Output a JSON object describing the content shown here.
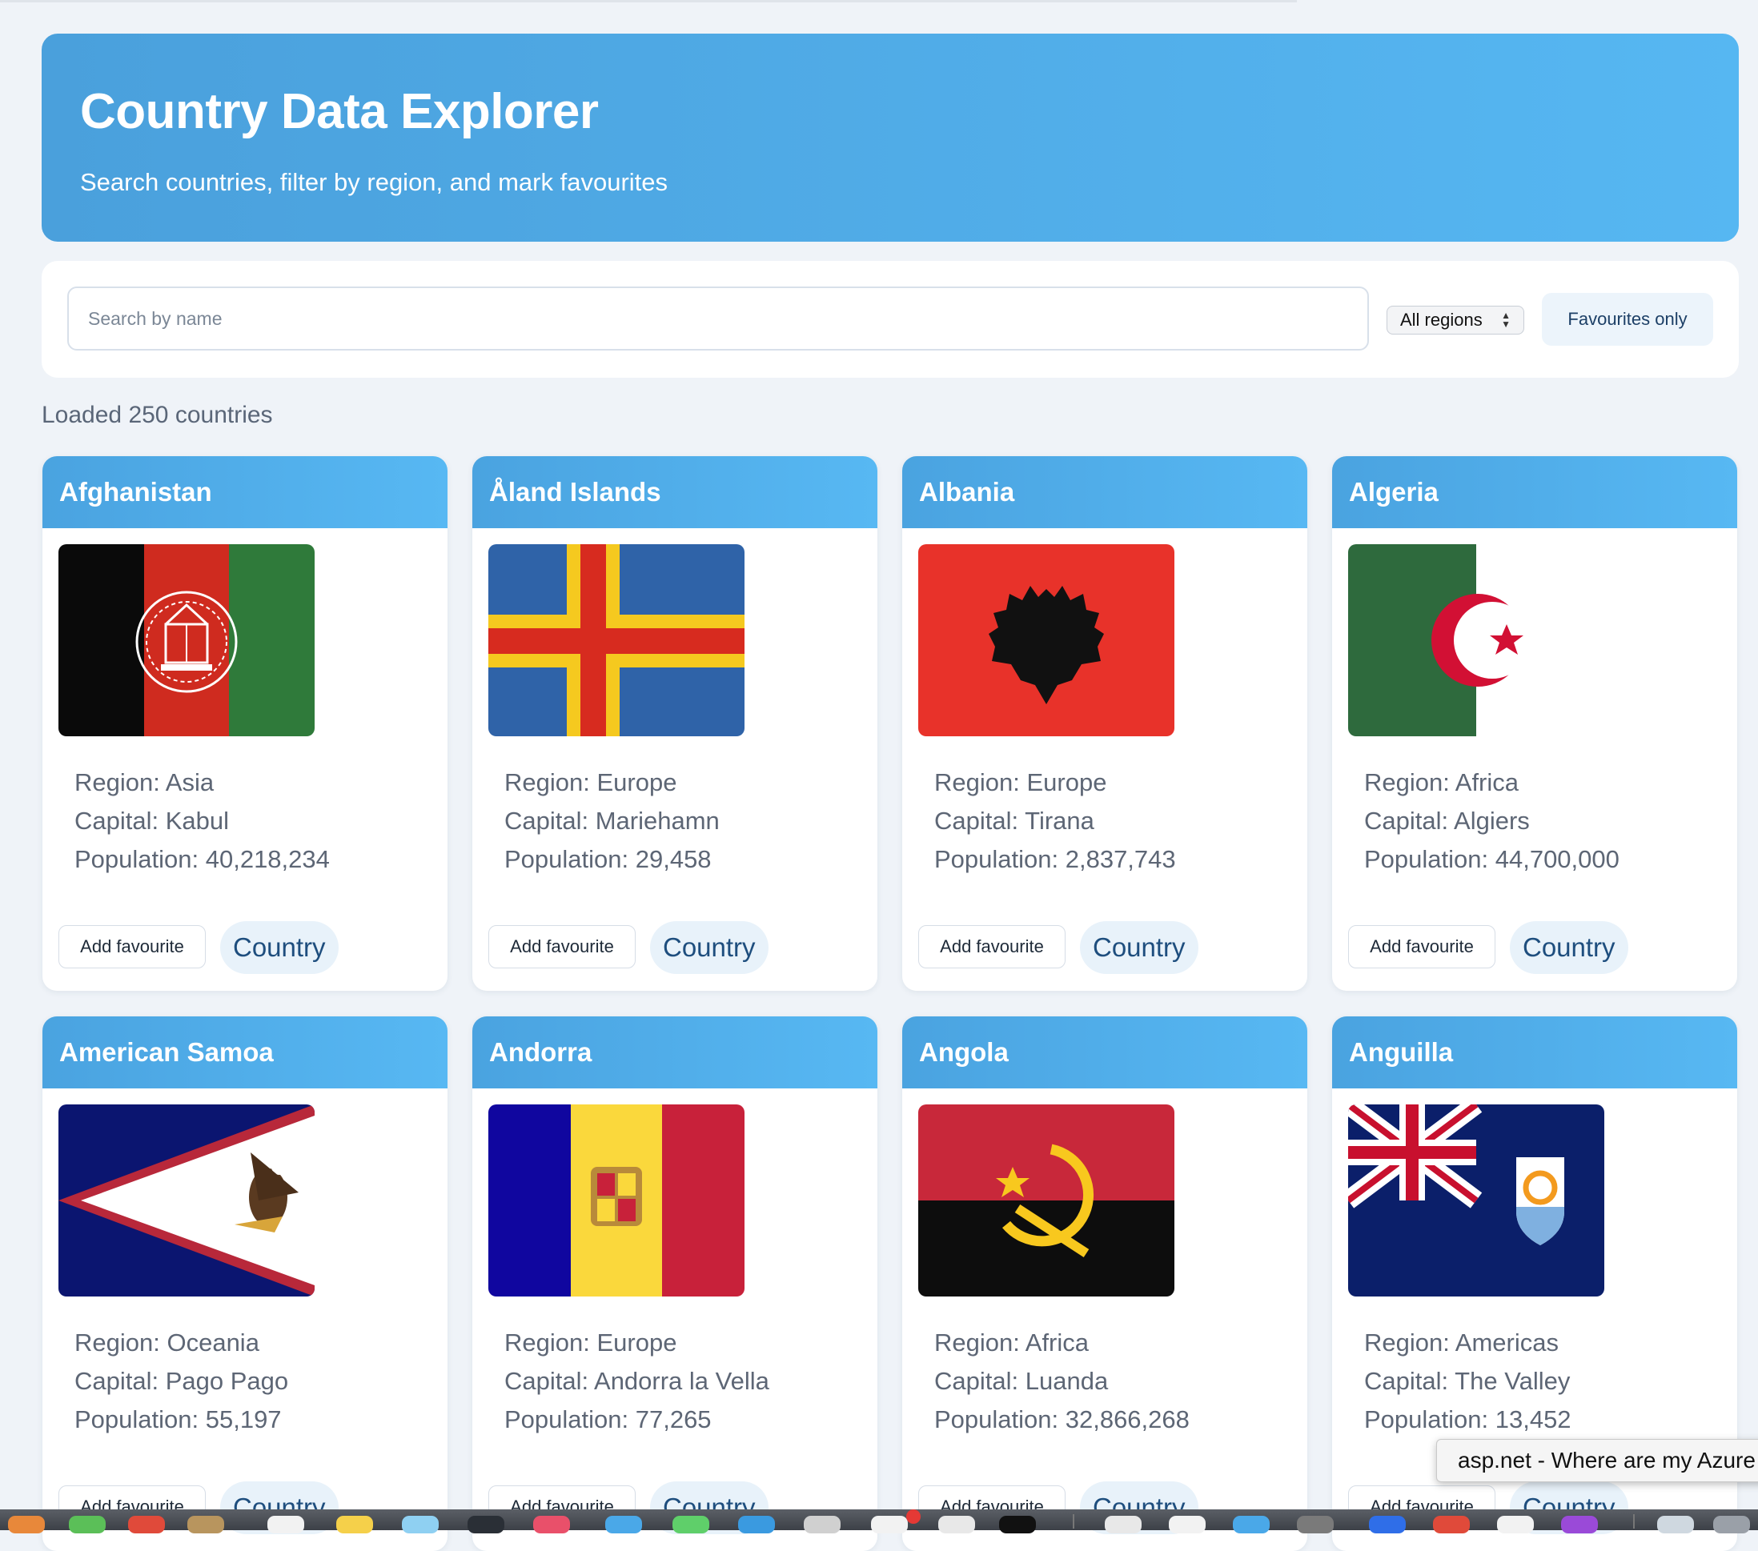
{
  "header": {
    "title": "Country Data Explorer",
    "subtitle": "Search countries, filter by region, and mark favourites"
  },
  "controls": {
    "search_placeholder": "Search by name",
    "search_value": "",
    "region_selected": "All regions",
    "favourites_label": "Favourites only"
  },
  "status": {
    "loaded_text": "Loaded 250 countries"
  },
  "labels": {
    "region": "Region: ",
    "capital": "Capital: ",
    "population": "Population: ",
    "add_favourite": "Add favourite",
    "country_tag": "Country"
  },
  "countries": [
    {
      "name": "Afghanistan",
      "region": "Asia",
      "capital": "Kabul",
      "population": "40,218,234",
      "flag_icon": "afghanistan-flag"
    },
    {
      "name": "Åland Islands",
      "region": "Europe",
      "capital": "Mariehamn",
      "population": "29,458",
      "flag_icon": "aland-islands-flag"
    },
    {
      "name": "Albania",
      "region": "Europe",
      "capital": "Tirana",
      "population": "2,837,743",
      "flag_icon": "albania-flag"
    },
    {
      "name": "Algeria",
      "region": "Africa",
      "capital": "Algiers",
      "population": "44,700,000",
      "flag_icon": "algeria-flag"
    },
    {
      "name": "American Samoa",
      "region": "Oceania",
      "capital": "Pago Pago",
      "population": "55,197",
      "flag_icon": "american-samoa-flag"
    },
    {
      "name": "Andorra",
      "region": "Europe",
      "capital": "Andorra la Vella",
      "population": "77,265",
      "flag_icon": "andorra-flag"
    },
    {
      "name": "Angola",
      "region": "Africa",
      "capital": "Luanda",
      "population": "32,866,268",
      "flag_icon": "angola-flag"
    },
    {
      "name": "Anguilla",
      "region": "Americas",
      "capital": "The Valley",
      "population": "13,452",
      "flag_icon": "anguilla-flag"
    }
  ],
  "tooltip": {
    "text": "asp.net - Where are my Azure"
  },
  "colors": {
    "header_gradient_start": "#4aa0dc",
    "header_gradient_end": "#56b7f2",
    "page_background": "#eff3f8",
    "pill_background": "#e8f2fa"
  }
}
